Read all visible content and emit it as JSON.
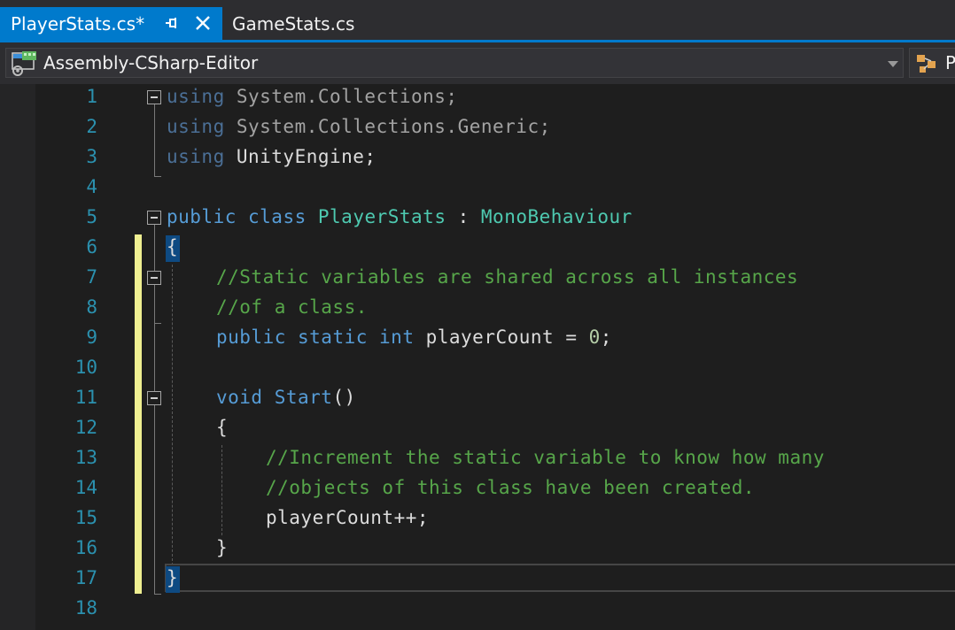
{
  "tabs": [
    {
      "label": "PlayerStats.cs*",
      "active": true
    },
    {
      "label": "GameStats.cs",
      "active": false
    }
  ],
  "navbar": {
    "project": "Assembly-CSharp-Editor",
    "member_partial": "P"
  },
  "editor": {
    "line_numbers": [
      "1",
      "2",
      "3",
      "4",
      "5",
      "6",
      "7",
      "8",
      "9",
      "10",
      "11",
      "12",
      "13",
      "14",
      "15",
      "16",
      "17",
      "18"
    ],
    "lines": [
      {
        "indent": 0,
        "tokens": [
          {
            "t": "using",
            "c": "kw-dim"
          },
          {
            "t": " System.Collections;",
            "c": "ns-dim"
          }
        ]
      },
      {
        "indent": 0,
        "tokens": [
          {
            "t": "using",
            "c": "kw-dim"
          },
          {
            "t": " System.Collections.Generic;",
            "c": "ns-dim"
          }
        ]
      },
      {
        "indent": 0,
        "tokens": [
          {
            "t": "using",
            "c": "kw-dim"
          },
          {
            "t": " UnityEngine;",
            "c": "txt"
          }
        ]
      },
      {
        "indent": 0,
        "tokens": []
      },
      {
        "indent": 0,
        "tokens": [
          {
            "t": "public",
            "c": "kw"
          },
          {
            "t": " ",
            "c": "txt"
          },
          {
            "t": "class",
            "c": "kw"
          },
          {
            "t": " ",
            "c": "txt"
          },
          {
            "t": "PlayerStats",
            "c": "type"
          },
          {
            "t": " : ",
            "c": "txt"
          },
          {
            "t": "MonoBehaviour",
            "c": "type"
          }
        ]
      },
      {
        "indent": 0,
        "tokens": [
          {
            "t": "{",
            "c": "txt"
          }
        ]
      },
      {
        "indent": 1,
        "tokens": [
          {
            "t": "//Static variables are shared across all instances",
            "c": "cm"
          }
        ]
      },
      {
        "indent": 1,
        "tokens": [
          {
            "t": "//of a class.",
            "c": "cm"
          }
        ]
      },
      {
        "indent": 1,
        "tokens": [
          {
            "t": "public",
            "c": "kw"
          },
          {
            "t": " ",
            "c": "txt"
          },
          {
            "t": "static",
            "c": "kw"
          },
          {
            "t": " ",
            "c": "txt"
          },
          {
            "t": "int",
            "c": "kw"
          },
          {
            "t": " playerCount = ",
            "c": "txt"
          },
          {
            "t": "0",
            "c": "num"
          },
          {
            "t": ";",
            "c": "txt"
          }
        ]
      },
      {
        "indent": 0,
        "tokens": []
      },
      {
        "indent": 1,
        "tokens": [
          {
            "t": "void",
            "c": "kw"
          },
          {
            "t": " ",
            "c": "txt"
          },
          {
            "t": "Start",
            "c": "kw"
          },
          {
            "t": "()",
            "c": "txt"
          }
        ]
      },
      {
        "indent": 1,
        "tokens": [
          {
            "t": "{",
            "c": "txt"
          }
        ]
      },
      {
        "indent": 2,
        "tokens": [
          {
            "t": "//Increment the static variable to know how many",
            "c": "cm"
          }
        ]
      },
      {
        "indent": 2,
        "tokens": [
          {
            "t": "//objects of this class have been created.",
            "c": "cm"
          }
        ]
      },
      {
        "indent": 2,
        "tokens": [
          {
            "t": "playerCount++;",
            "c": "txt"
          }
        ]
      },
      {
        "indent": 1,
        "tokens": [
          {
            "t": "}",
            "c": "txt"
          }
        ]
      },
      {
        "indent": 0,
        "tokens": [
          {
            "t": "}",
            "c": "txt"
          }
        ]
      },
      {
        "indent": 0,
        "tokens": []
      }
    ]
  },
  "colors": {
    "accent": "#007acc",
    "keyword": "#569cd6",
    "type": "#4ec9b0",
    "comment": "#57a64a",
    "line_number": "#2b91af",
    "change_marker": "#efef91"
  },
  "icons": {
    "project": "csharp-project-icon",
    "member": "class-member-icon",
    "pin": "pin-icon",
    "close": "close-icon"
  }
}
